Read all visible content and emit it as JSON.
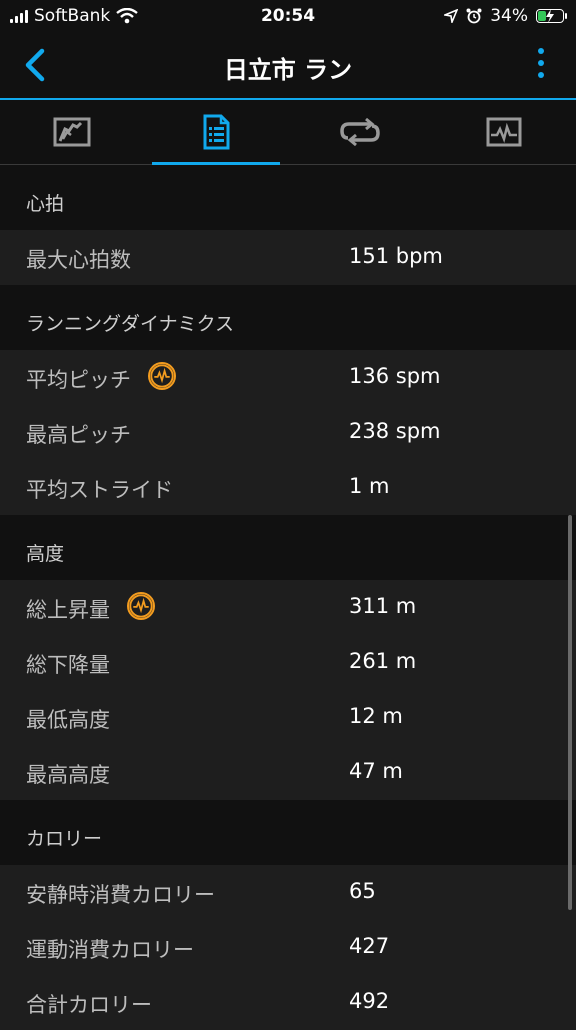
{
  "status": {
    "carrier": "SoftBank",
    "time": "20:54",
    "battery": "34%",
    "battery_level": 0.34
  },
  "nav": {
    "title": "日立市 ラン",
    "back_icon": "chevron-left-icon",
    "more_icon": "vertical-ellipsis-icon"
  },
  "tabs": [
    {
      "icon": "map-icon",
      "active": false
    },
    {
      "icon": "document-list-icon",
      "active": true
    },
    {
      "icon": "laps-loop-icon",
      "active": false
    },
    {
      "icon": "chart-icon",
      "active": false
    }
  ],
  "sections": {
    "heart": {
      "title": "心拍",
      "rows": [
        {
          "label": "最大心拍数",
          "value": "151 bpm"
        }
      ]
    },
    "dynamics": {
      "title": "ランニングダイナミクス",
      "rows": [
        {
          "label": "平均ピッチ",
          "value": "136 spm"
        },
        {
          "label": "最高ピッチ",
          "value": "238 spm"
        },
        {
          "label": "平均ストライド",
          "value": "1 m"
        }
      ]
    },
    "elevation": {
      "title": "高度",
      "rows": [
        {
          "label": "総上昇量",
          "value": "311 m"
        },
        {
          "label": "総下降量",
          "value": "261 m"
        },
        {
          "label": "最低高度",
          "value": "12 m"
        },
        {
          "label": "最高高度",
          "value": "47 m"
        }
      ]
    },
    "calories": {
      "title": "カロリー",
      "rows": [
        {
          "label": "安静時消費カロリー",
          "value": "65"
        },
        {
          "label": "運動消費カロリー",
          "value": "427"
        },
        {
          "label": "合計カロリー",
          "value": "492"
        }
      ]
    }
  },
  "colors": {
    "accent": "#11a9ed",
    "badge": "#f39c1f",
    "row_bg": "#1e1e1e",
    "page_bg": "#111111"
  }
}
